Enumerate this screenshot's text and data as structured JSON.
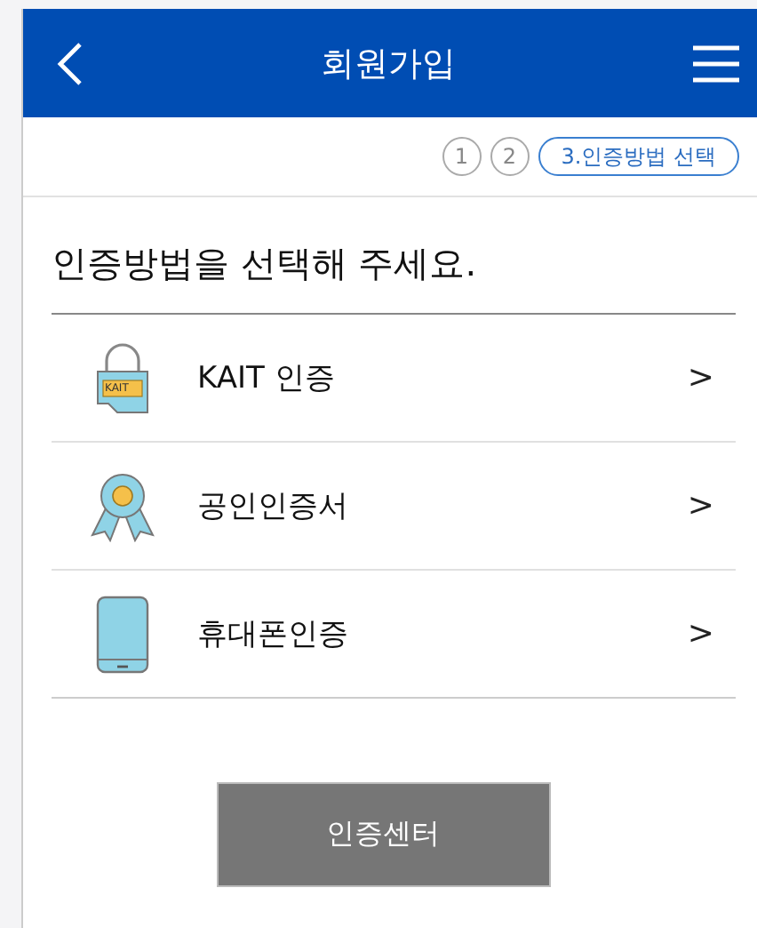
{
  "header": {
    "title": "회원가입"
  },
  "steps": [
    {
      "label": "1",
      "selected": false
    },
    {
      "label": "2",
      "selected": false
    },
    {
      "label": "3.인증방법 선택",
      "selected": true
    }
  ],
  "heading": "인증방법을 선택해 주세요.",
  "methods": [
    {
      "kind": "lock",
      "icon_text": "KAIT",
      "label": "KAIT 인증",
      "chevron": ">"
    },
    {
      "kind": "medal",
      "label": "공인인증서",
      "chevron": ">"
    },
    {
      "kind": "phone",
      "label": "휴대폰인증",
      "chevron": ">"
    }
  ],
  "button": "인증센터"
}
